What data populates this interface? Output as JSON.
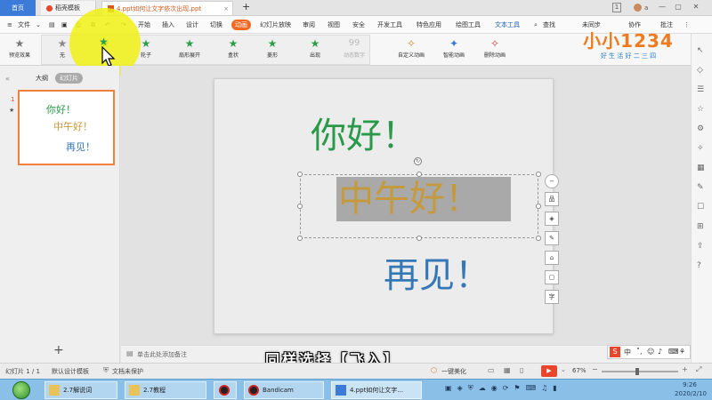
{
  "titlebar": {
    "tabs": [
      {
        "label": "首页"
      },
      {
        "label": "稻壳模板"
      },
      {
        "label": "4.ppt如何让文字依次出现.ppt"
      }
    ],
    "new_tab": "+",
    "page_count": "1",
    "user_initial": "a"
  },
  "menubar": {
    "file_label": "文件",
    "items": [
      "开始",
      "插入",
      "设计",
      "切换",
      "动画",
      "幻灯片放映",
      "审阅",
      "视图",
      "安全",
      "开发工具",
      "特色应用",
      "绘图工具",
      "文本工具"
    ],
    "search_label": "查找",
    "sync_label": "未同步",
    "collab_label": "协作",
    "comment_label": "批注"
  },
  "ribbon": {
    "preview_label": "预览效果",
    "gallery": [
      {
        "label": "无"
      },
      {
        "label": "飞入"
      },
      {
        "label": "轮子"
      },
      {
        "label": "扇形展开"
      },
      {
        "label": "盒状"
      },
      {
        "label": "菱形"
      },
      {
        "label": "出现"
      },
      {
        "label": "动态数字"
      }
    ],
    "custom_label": "自定义动画",
    "smart_label": "智能动画",
    "delete_label": "删除动画"
  },
  "logo": {
    "brand": "小小1234",
    "slogan": "好 生 活 好 二 三 四"
  },
  "panel": {
    "tab_outline": "大纲",
    "tab_slides": "幻灯片",
    "slide_number": "1",
    "thumb_lines": [
      "你好！",
      "中午好！",
      "再见！"
    ],
    "add_label": "+"
  },
  "slide": {
    "line1": "你好！",
    "line2": "中午好！",
    "line3": "再见！"
  },
  "side_tools": [
    "−",
    "品",
    "◈",
    "✎",
    "⌂",
    "▢",
    "字"
  ],
  "notes": {
    "placeholder": "单击此处添加备注"
  },
  "statusbar": {
    "slide_info": "幻灯片 1 / 1",
    "theme": "默认设计模板",
    "protect": "文档未保护",
    "beautify": "一键美化",
    "zoom": "67%"
  },
  "subtitle": "同样选择【飞入】",
  "taskbar": {
    "items": [
      {
        "label": "2.7解说词"
      },
      {
        "label": "2.7教程"
      },
      {
        "label": ""
      },
      {
        "label": "Bandicam"
      },
      {
        "label": "4.ppt如何让文字..."
      }
    ],
    "time": "9:26",
    "date": "2020/2/10"
  },
  "colors": {
    "accent": "#f06a25",
    "line1": "#2a9a4a",
    "line2": "#c49a3c",
    "line3": "#3578b5",
    "selection": "#a9a9a9",
    "cursor_highlight": "#f0f014"
  }
}
